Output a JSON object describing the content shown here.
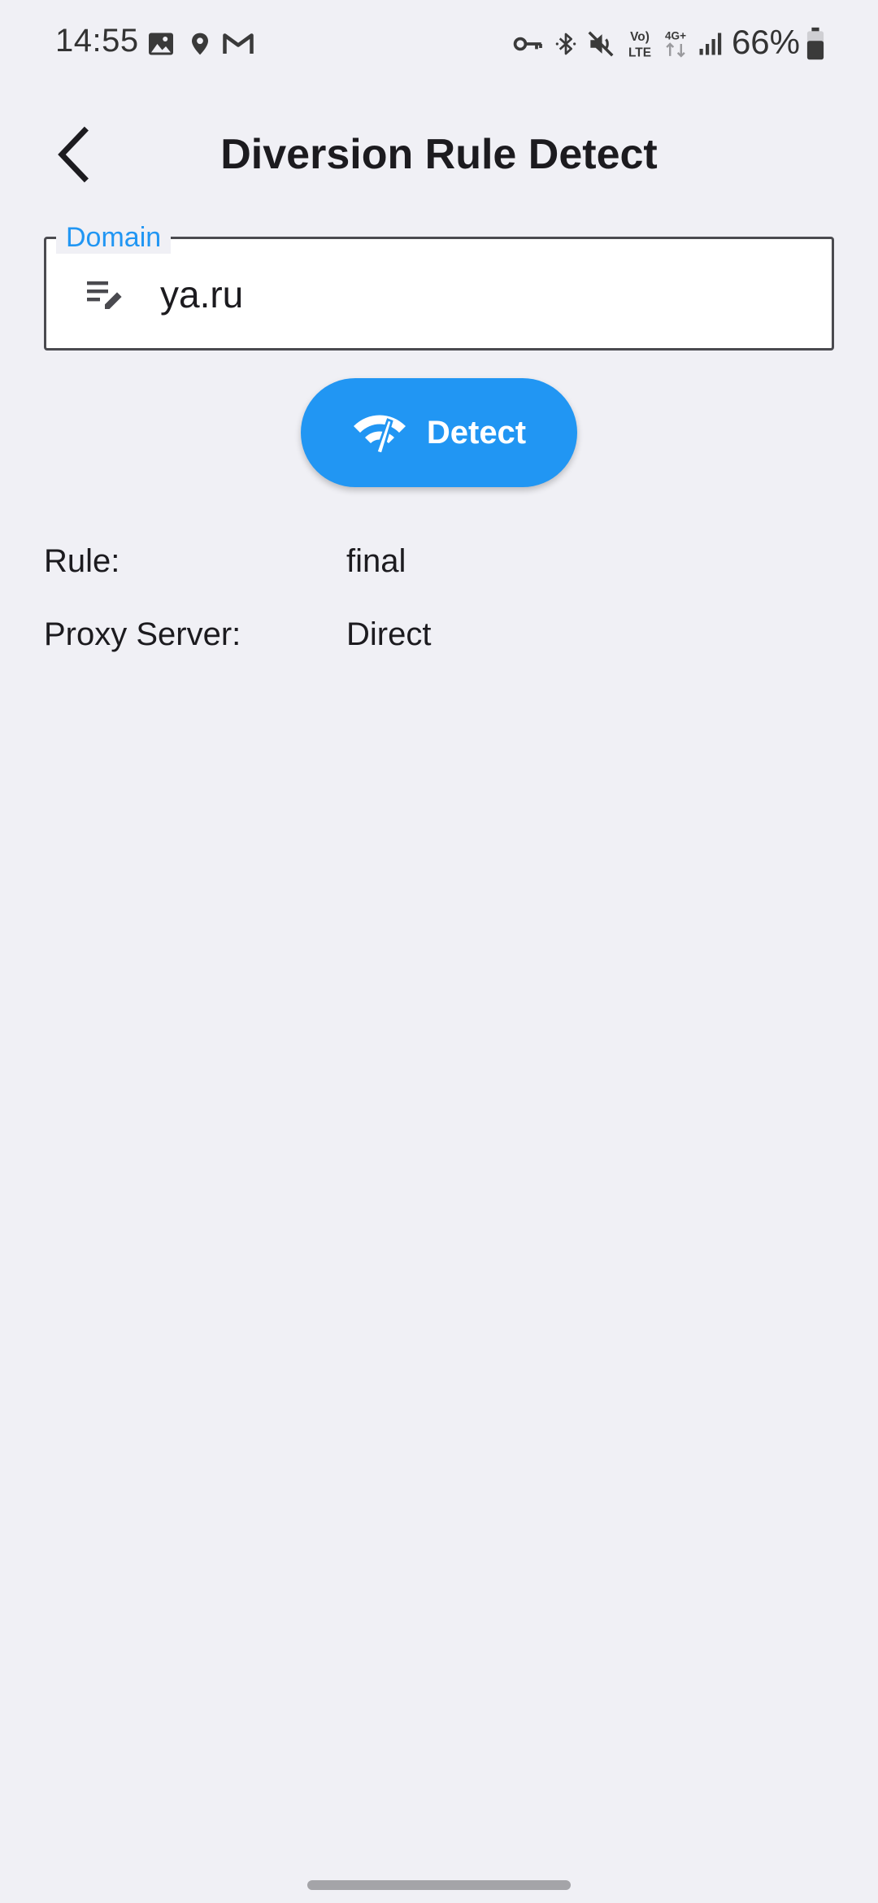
{
  "status_bar": {
    "time": "14:55",
    "battery_percent": "66%",
    "battery_level": 0.66,
    "left_icons": [
      "gallery-icon",
      "location-icon",
      "gmail-icon"
    ],
    "right_icons": [
      "vpn-key-icon",
      "bluetooth-icon",
      "mute-icon",
      "volte-icon",
      "4g-data-icon",
      "signal-icon",
      "battery-icon"
    ],
    "volte_label_top": "Vo)",
    "volte_label_bottom": "LTE",
    "network_label": "4G+"
  },
  "app_bar": {
    "title": "Diversion Rule Detect",
    "back_icon": "chevron-left-icon"
  },
  "domain_field": {
    "label": "Domain",
    "value": "ya.ru",
    "icon": "edit-note-icon",
    "accent_color": "#2196f3"
  },
  "detect_button": {
    "label": "Detect",
    "icon": "network-check-icon",
    "color": "#2196f3"
  },
  "results": {
    "rule_label": "Rule:",
    "rule_value": "final",
    "proxy_label": "Proxy Server:",
    "proxy_value": "Direct"
  },
  "colors": {
    "background": "#f0f0f5",
    "text": "#1c1b1f"
  }
}
